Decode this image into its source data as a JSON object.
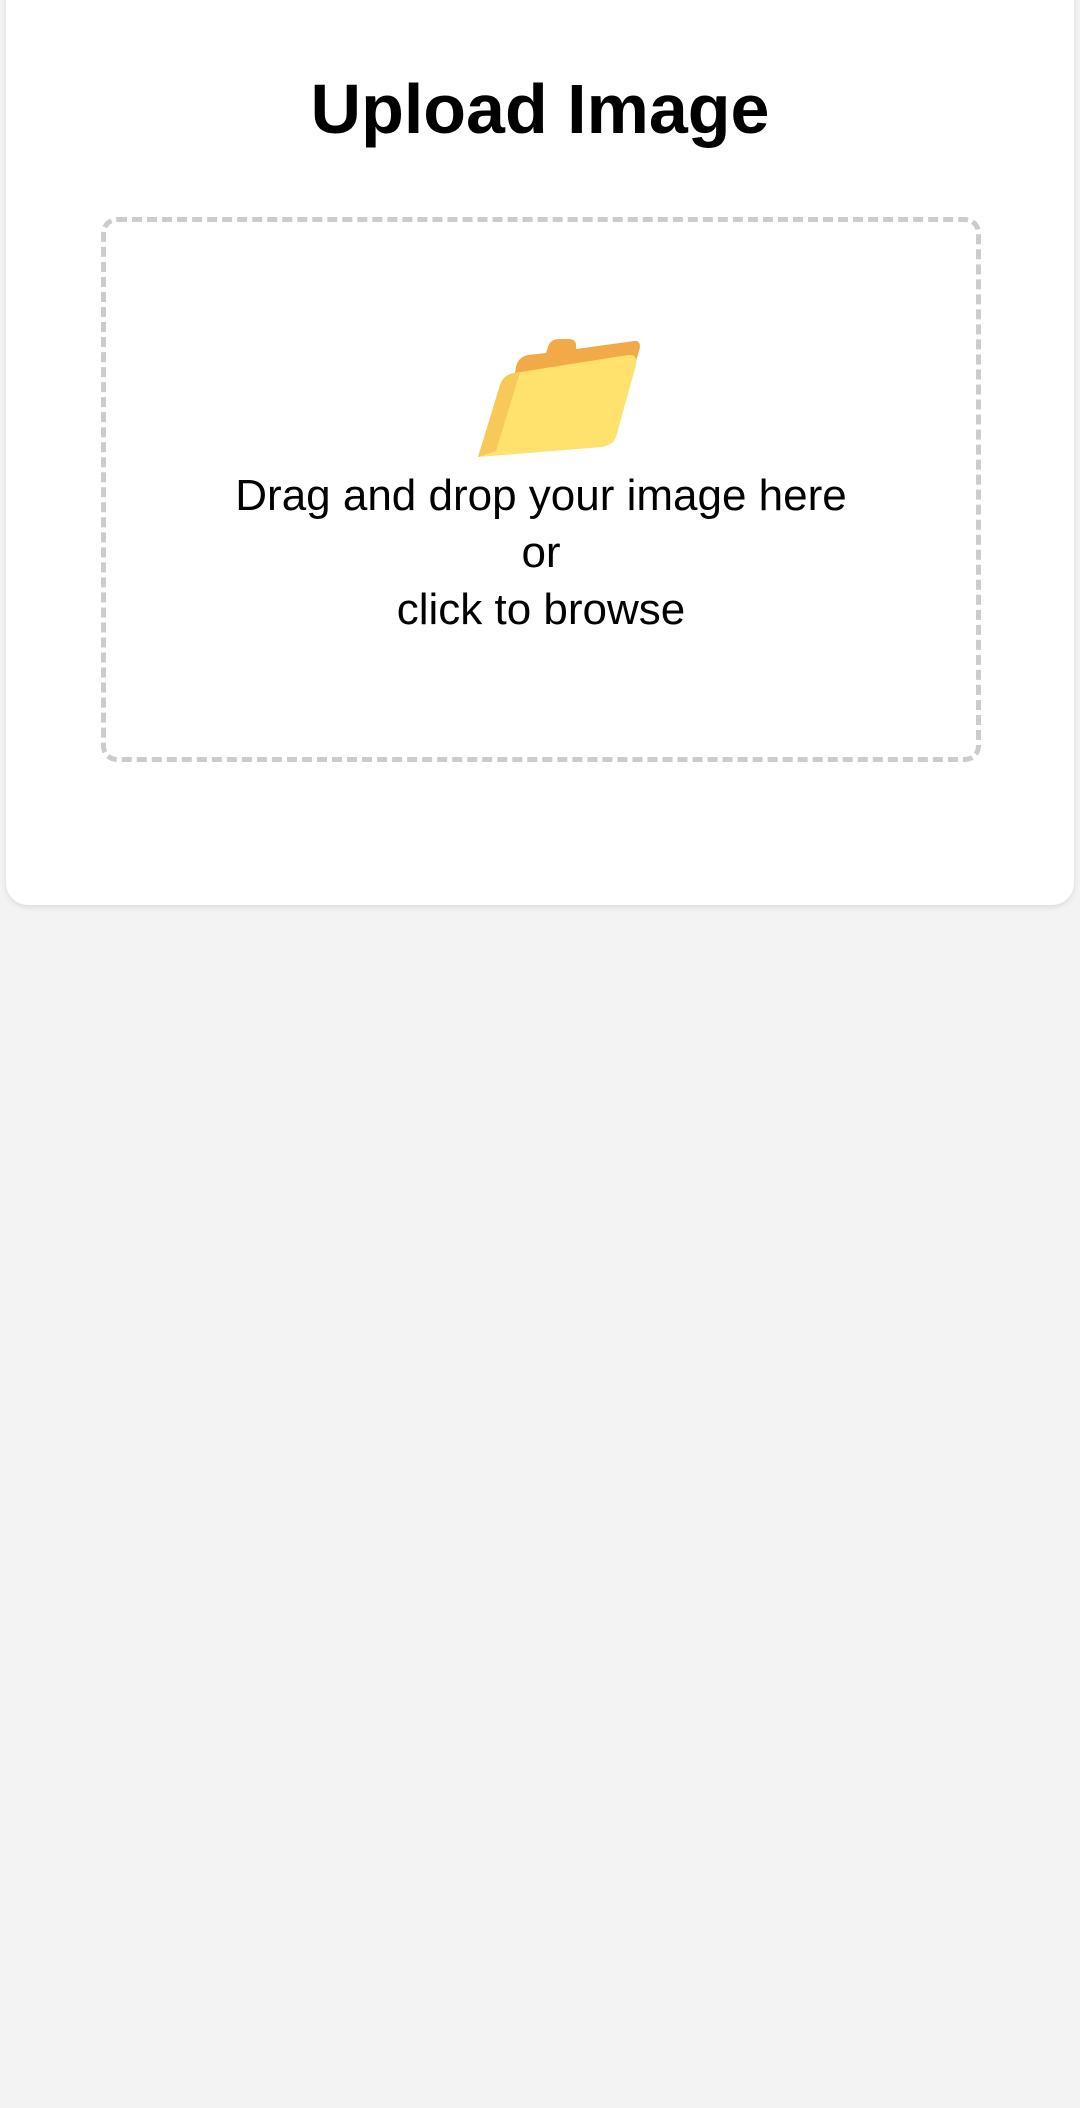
{
  "upload": {
    "title": "Upload Image",
    "dropzone": {
      "icon": "folder-icon",
      "line1": "Drag and drop your image here",
      "line2": "or",
      "line3": "click to browse"
    }
  },
  "colors": {
    "page_background": "#f3f3f3",
    "card_background": "#ffffff",
    "dropzone_border": "#cccccc",
    "folder_front": "#ffe16e",
    "folder_back": "#f2aa48"
  }
}
